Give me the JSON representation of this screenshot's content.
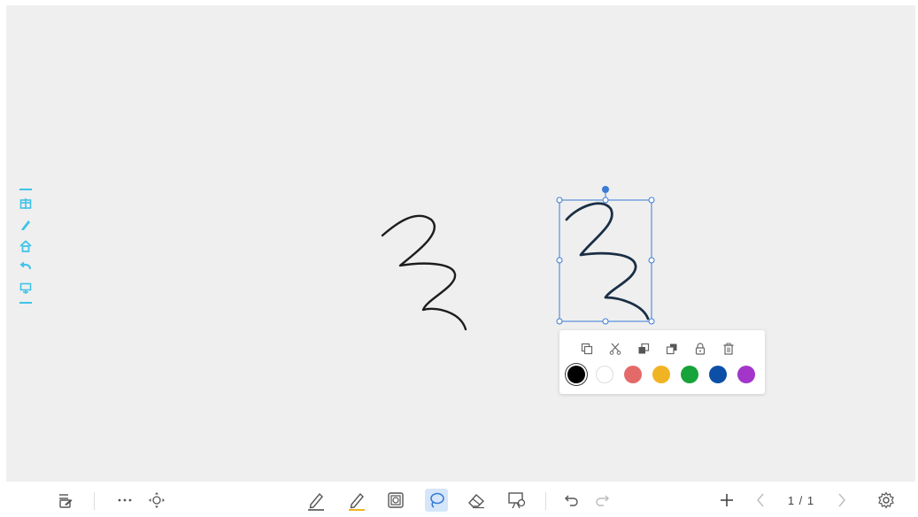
{
  "side_rail": {
    "color": "#3fc3e8",
    "icons": [
      "window-icon",
      "pen-icon",
      "home-icon",
      "back-icon",
      "board-icon"
    ]
  },
  "selection": {
    "accent_color": "#3a7bd5"
  },
  "context_menu": {
    "actions": [
      "copy-icon",
      "cut-icon",
      "bring-to-front-icon",
      "send-to-back-icon",
      "lock-icon",
      "delete-icon"
    ],
    "colors": [
      {
        "name": "black",
        "hex": "#000000",
        "selected": true
      },
      {
        "name": "white",
        "hex": "#ffffff",
        "selected": false
      },
      {
        "name": "red",
        "hex": "#e46a6a",
        "selected": false
      },
      {
        "name": "yellow",
        "hex": "#f0b323",
        "selected": false
      },
      {
        "name": "green",
        "hex": "#16a33a",
        "selected": false
      },
      {
        "name": "blue",
        "hex": "#0b4fa6",
        "selected": false
      },
      {
        "name": "purple",
        "hex": "#a336c9",
        "selected": false
      }
    ]
  },
  "toolbar": {
    "left_icons": [
      "exit-note-icon",
      "more-icon",
      "move-icon"
    ],
    "center_icons": [
      "pen-icon",
      "highlighter-icon",
      "shape-icon",
      "lasso-select-icon",
      "eraser-icon",
      "board-manage-icon"
    ],
    "active_tool": "lasso-select-icon",
    "active_tool_bg": "#d6e6fa",
    "highlighter_color": "#f0b323",
    "history_icons": [
      "undo-icon",
      "redo-icon"
    ],
    "page_indicator": "1 / 1"
  }
}
